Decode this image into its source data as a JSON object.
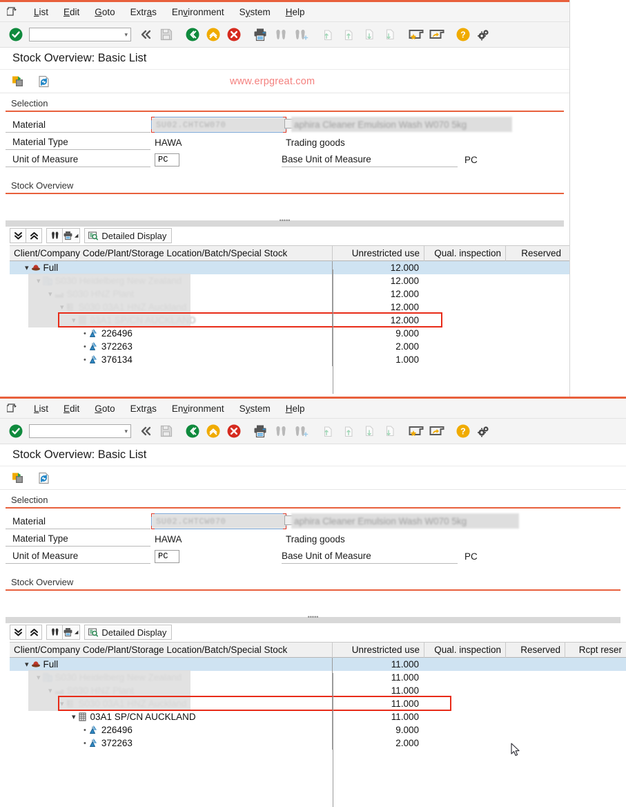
{
  "app": {
    "title": "Stock Overview: Basic List",
    "watermark": "www.erpgreat.com"
  },
  "menu": {
    "items": [
      {
        "label": "List",
        "accel": "L"
      },
      {
        "label": "Edit",
        "accel": "E"
      },
      {
        "label": "Goto",
        "accel": "G"
      },
      {
        "label": "Extras",
        "accel": "a"
      },
      {
        "label": "Environment",
        "accel": "v"
      },
      {
        "label": "System",
        "accel": "y"
      },
      {
        "label": "Help",
        "accel": "H"
      }
    ]
  },
  "toolbar": {
    "command_value": "",
    "command_placeholder": "",
    "icons": [
      "enter-check-icon",
      "collapse-left-icon",
      "save-icon",
      "back-icon",
      "exit-icon",
      "cancel-icon",
      "print-icon",
      "find-icon",
      "find-next-icon",
      "first-page-icon",
      "previous-page-icon",
      "next-page-icon",
      "last-page-icon",
      "create-shortcut-icon",
      "customize-local-layout-icon",
      "help-icon",
      "settings-icon"
    ]
  },
  "apptoolbar": {
    "icons": [
      "copy-to-clipboard-icon",
      "refresh-icon"
    ]
  },
  "selection": {
    "group_title": "Selection",
    "material_label": "Material",
    "material_value": "SU02.CHTCW070",
    "material_desc": "aphira Cleaner Emulsion Wash W070 5kg",
    "material_type_label": "Material Type",
    "material_type_value": "HAWA",
    "material_type_desc": "Trading goods",
    "uom_label": "Unit of Measure",
    "uom_value": "PC",
    "base_uom_label": "Base Unit of Measure",
    "base_uom_value": "PC"
  },
  "stock_overview": {
    "group_title": "Stock Overview",
    "list_toolbar": {
      "expand_all": "expand-all-icon",
      "collapse_all": "collapse-all-icon",
      "find": "find-icon",
      "print": "print-icon",
      "print_menu": "dropdown-arrow-icon",
      "detailed_display_icon": "detailed-display-icon",
      "detailed_display_label": "Detailed Display"
    }
  },
  "panel1": {
    "columns": [
      "Client/Company Code/Plant/Storage Location/Batch/Special Stock",
      "Unrestricted use",
      "Qual. inspection",
      "Reserved"
    ],
    "rows": [
      {
        "indent": 0,
        "icon": "full-stock-icon",
        "expander": "chevron-down-icon",
        "label": "Full",
        "unrestricted": "12.000",
        "selected": true,
        "blurred": false,
        "highlighted": false
      },
      {
        "indent": 1,
        "icon": "company-code-icon",
        "expander": "chevron-down-icon",
        "label": "S030 Heidelberg New Zealand",
        "unrestricted": "12.000",
        "selected": false,
        "blurred": true,
        "highlighted": false
      },
      {
        "indent": 2,
        "icon": "plant-icon",
        "expander": "chevron-down-icon",
        "label": "S030 HNZ Plant",
        "unrestricted": "12.000",
        "selected": false,
        "blurred": true,
        "highlighted": false
      },
      {
        "indent": 3,
        "icon": "storage-location-icon",
        "expander": "chevron-down-icon",
        "label": "S030 03A1 HNZ Auckland",
        "unrestricted": "12.000",
        "selected": false,
        "blurred": true,
        "highlighted": false
      },
      {
        "indent": 4,
        "icon": "special-stock-icon",
        "expander": "chevron-down-icon",
        "label": "03A1 SP/CN AUCKLAND",
        "unrestricted": "12.000",
        "selected": false,
        "blurred": true,
        "highlighted": true
      },
      {
        "indent": 5,
        "icon": "batch-icon",
        "expander": "bullet",
        "label": "226496",
        "unrestricted": "9.000",
        "selected": false,
        "blurred": false,
        "highlighted": false
      },
      {
        "indent": 5,
        "icon": "batch-icon",
        "expander": "bullet",
        "label": "372263",
        "unrestricted": "2.000",
        "selected": false,
        "blurred": false,
        "highlighted": false
      },
      {
        "indent": 5,
        "icon": "batch-icon",
        "expander": "bullet",
        "label": "376134",
        "unrestricted": "1.000",
        "selected": false,
        "blurred": false,
        "highlighted": false
      }
    ]
  },
  "panel2": {
    "columns": [
      "Client/Company Code/Plant/Storage Location/Batch/Special Stock",
      "Unrestricted use",
      "Qual. inspection",
      "Reserved",
      "Rcpt reser"
    ],
    "rows": [
      {
        "indent": 0,
        "icon": "full-stock-icon",
        "expander": "chevron-down-icon",
        "label": "Full",
        "unrestricted": "11.000",
        "selected": true,
        "blurred": false,
        "highlighted": false
      },
      {
        "indent": 1,
        "icon": "company-code-icon",
        "expander": "chevron-down-icon",
        "label": "S030 Heidelberg New Zealand",
        "unrestricted": "11.000",
        "selected": false,
        "blurred": true,
        "highlighted": false
      },
      {
        "indent": 2,
        "icon": "plant-icon",
        "expander": "chevron-down-icon",
        "label": "S030 HNZ Plant",
        "unrestricted": "11.000",
        "selected": false,
        "blurred": true,
        "highlighted": false
      },
      {
        "indent": 3,
        "icon": "storage-location-icon",
        "expander": "chevron-down-icon",
        "label": "S030 03A1 HNZ Auckland",
        "unrestricted": "11.000",
        "selected": false,
        "blurred": true,
        "highlighted": true
      },
      {
        "indent": 4,
        "icon": "special-stock-icon",
        "expander": "chevron-down-icon",
        "label": "03A1 SP/CN AUCKLAND",
        "unrestricted": "11.000",
        "selected": false,
        "blurred": false,
        "highlighted": false
      },
      {
        "indent": 5,
        "icon": "batch-icon",
        "expander": "bullet",
        "label": "226496",
        "unrestricted": "9.000",
        "selected": false,
        "blurred": false,
        "highlighted": false
      },
      {
        "indent": 5,
        "icon": "batch-icon",
        "expander": "bullet",
        "label": "372263",
        "unrestricted": "2.000",
        "selected": false,
        "blurred": false,
        "highlighted": false
      }
    ]
  },
  "colors": {
    "accent_orange": "#E8603C",
    "selection_blue": "#CFE3F2",
    "highlight_red": "#E82B18",
    "watermark_pink": "#F4817F"
  }
}
